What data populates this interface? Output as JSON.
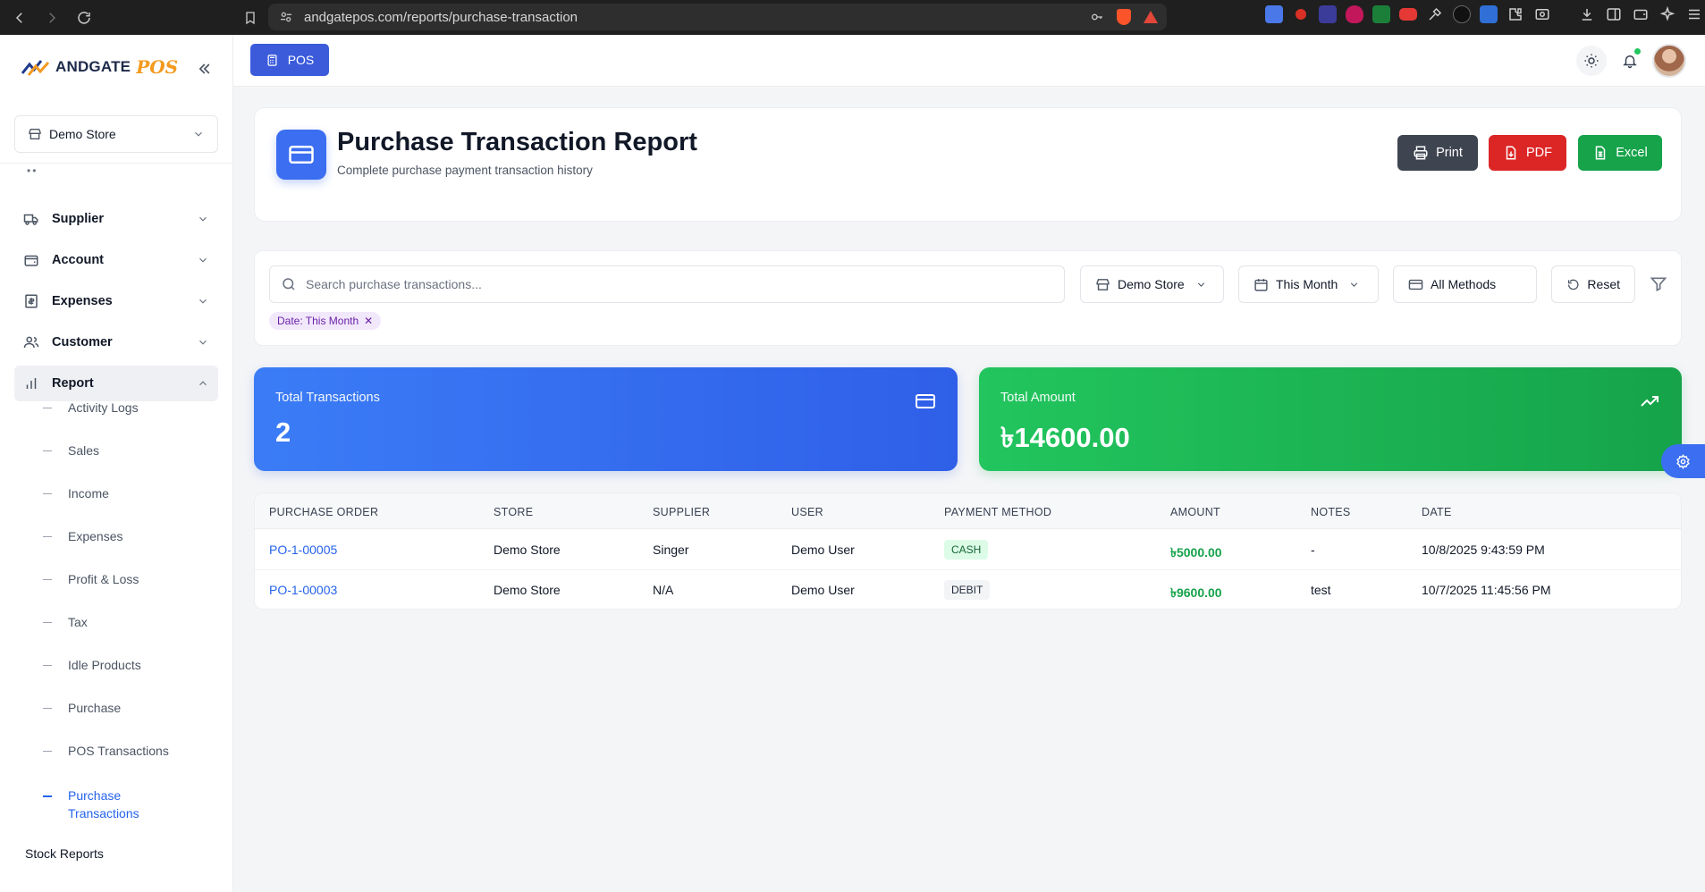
{
  "browser": {
    "url": "andgatepos.com/reports/purchase-transaction"
  },
  "sidebar": {
    "logo_text": "ANDGATE",
    "logo_accent": "POS",
    "store": "Demo Store",
    "items": [
      {
        "label": "Supplier",
        "icon": "truck-icon"
      },
      {
        "label": "Account",
        "icon": "wallet-icon"
      },
      {
        "label": "Expenses",
        "icon": "receipt-icon"
      },
      {
        "label": "Customer",
        "icon": "users-icon"
      },
      {
        "label": "Report",
        "icon": "bar-chart-icon"
      }
    ],
    "report_subitems": [
      "Activity Logs",
      "Sales",
      "Income",
      "Expenses",
      "Profit & Loss",
      "Tax",
      "Idle Products",
      "Purchase",
      "POS Transactions",
      "Purchase Transactions"
    ],
    "stock_reports": "Stock Reports"
  },
  "topbar": {
    "pos_label": "POS"
  },
  "header": {
    "title": "Purchase Transaction Report",
    "subtitle": "Complete purchase payment transaction history",
    "print_label": "Print",
    "pdf_label": "PDF",
    "excel_label": "Excel"
  },
  "filters": {
    "search_placeholder": "Search purchase transactions...",
    "store": "Demo Store",
    "period": "This Month",
    "method": "All Methods",
    "reset_label": "Reset",
    "chip": "Date: This Month"
  },
  "stats": {
    "total_transactions_label": "Total Transactions",
    "total_transactions_value": "2",
    "total_amount_label": "Total Amount",
    "total_amount_value": "৳14600.00"
  },
  "table": {
    "headers": [
      "PURCHASE ORDER",
      "STORE",
      "SUPPLIER",
      "USER",
      "PAYMENT METHOD",
      "AMOUNT",
      "NOTES",
      "DATE"
    ],
    "rows": [
      {
        "po": "PO-1-00005",
        "store": "Demo Store",
        "supplier": "Singer",
        "user": "Demo User",
        "method": "CASH",
        "amount": "৳5000.00",
        "notes": "-",
        "date": "10/8/2025 9:43:59 PM"
      },
      {
        "po": "PO-1-00003",
        "store": "Demo Store",
        "supplier": "N/A",
        "user": "Demo User",
        "method": "DEBIT",
        "amount": "৳9600.00",
        "notes": "test",
        "date": "10/7/2025 11:45:56 PM"
      }
    ]
  },
  "colors": {
    "primary": "#3b6ef0",
    "pdf": "#dc2626",
    "excel": "#16a34a",
    "print": "#374151"
  }
}
